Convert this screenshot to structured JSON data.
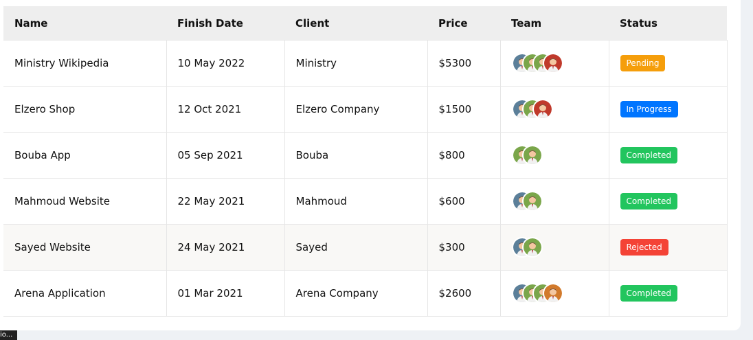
{
  "table": {
    "headers": [
      "Name",
      "Finish Date",
      "Client",
      "Price",
      "Team",
      "Status"
    ],
    "rows": [
      {
        "name": "Ministry Wikipedia",
        "finish_date": "10 May 2022",
        "client": "Ministry",
        "price": "$5300",
        "team": [
          "avatar-blue",
          "avatar-green",
          "avatar-green",
          "avatar-red"
        ],
        "status": "Pending",
        "status_color": "#f59e0b"
      },
      {
        "name": "Elzero Shop",
        "finish_date": "12 Oct 2021",
        "client": "Elzero Company",
        "price": "$1500",
        "team": [
          "avatar-blue",
          "avatar-green",
          "avatar-red"
        ],
        "status": "In Progress",
        "status_color": "#0075ff"
      },
      {
        "name": "Bouba App",
        "finish_date": "05 Sep 2021",
        "client": "Bouba",
        "price": "$800",
        "team": [
          "avatar-green",
          "avatar-green"
        ],
        "status": "Completed",
        "status_color": "#22c55e"
      },
      {
        "name": "Mahmoud Website",
        "finish_date": "22 May 2021",
        "client": "Mahmoud",
        "price": "$600",
        "team": [
          "avatar-blue",
          "avatar-green"
        ],
        "status": "Completed",
        "status_color": "#22c55e"
      },
      {
        "name": "Sayed Website",
        "finish_date": "24 May 2021",
        "client": "Sayed",
        "price": "$300",
        "team": [
          "avatar-blue",
          "avatar-green"
        ],
        "status": "Rejected",
        "status_color": "#f44336"
      },
      {
        "name": "Arena Application",
        "finish_date": "01 Mar 2021",
        "client": "Arena Company",
        "price": "$2600",
        "team": [
          "avatar-blue",
          "avatar-green",
          "avatar-green",
          "avatar-orange"
        ],
        "status": "Completed",
        "status_color": "#22c55e"
      }
    ]
  },
  "tooltip": {
    "text": "io..."
  },
  "avatar_colors": {
    "avatar-blue": "#5b7f99",
    "avatar-green": "#7aa64a",
    "avatar-red": "#c0392b",
    "avatar-orange": "#d27a2c"
  }
}
